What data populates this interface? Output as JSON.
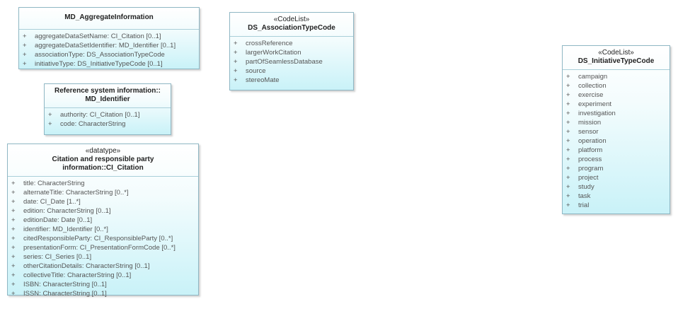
{
  "classes": {
    "md_aggregate": {
      "name": "MD_AggregateInformation",
      "attributes": [
        {
          "vis": "+",
          "text": "aggregateDataSetName: CI_Citation [0..1]"
        },
        {
          "vis": "+",
          "text": "aggregateDataSetIdentifier: MD_Identifier [0..1]"
        },
        {
          "vis": "+",
          "text": "associationType: DS_AssociationTypeCode"
        },
        {
          "vis": "+",
          "text": "initiativeType: DS_InitiativeTypeCode [0..1]"
        }
      ]
    },
    "md_identifier": {
      "name_line1": "Reference system information::",
      "name_line2": "MD_Identifier",
      "attributes": [
        {
          "vis": "+",
          "text": "authority: CI_Citation [0..1]"
        },
        {
          "vis": "+",
          "text": "code: CharacterString"
        }
      ]
    },
    "ci_citation": {
      "stereotype": "«datatype»",
      "name": "Citation and responsible party information::CI_Citation",
      "attributes": [
        {
          "vis": "+",
          "text": "title: CharacterString"
        },
        {
          "vis": "+",
          "text": "alternateTitle: CharacterString [0..*]"
        },
        {
          "vis": "+",
          "text": "date: CI_Date [1..*]"
        },
        {
          "vis": "+",
          "text": "edition: CharacterString [0..1]"
        },
        {
          "vis": "+",
          "text": "editionDate: Date [0..1]"
        },
        {
          "vis": "+",
          "text": "identifier: MD_Identifier [0..*]"
        },
        {
          "vis": "+",
          "text": "citedResponsibleParty: CI_ResponsibleParty [0..*]"
        },
        {
          "vis": "+",
          "text": "presentationForm: CI_PresentationFormCode [0..*]"
        },
        {
          "vis": "+",
          "text": "series: CI_Series [0..1]"
        },
        {
          "vis": "+",
          "text": "otherCitationDetails: CharacterString [0..1]"
        },
        {
          "vis": "+",
          "text": "collectiveTitle: CharacterString [0..1]"
        },
        {
          "vis": "+",
          "text": "ISBN: CharacterString [0..1]"
        },
        {
          "vis": "+",
          "text": "ISSN: CharacterString [0..1]"
        }
      ]
    },
    "association_type": {
      "stereotype": "«CodeList»",
      "name": "DS_AssociationTypeCode",
      "attributes": [
        {
          "vis": "+",
          "text": "crossReference"
        },
        {
          "vis": "+",
          "text": "largerWorkCitation"
        },
        {
          "vis": "+",
          "text": "partOfSeamlessDatabase"
        },
        {
          "vis": "+",
          "text": "source"
        },
        {
          "vis": "+",
          "text": "stereoMate"
        }
      ]
    },
    "initiative_type": {
      "stereotype": "«CodeList»",
      "name": "DS_InitiativeTypeCode",
      "attributes": [
        {
          "vis": "+",
          "text": "campaign"
        },
        {
          "vis": "+",
          "text": "collection"
        },
        {
          "vis": "+",
          "text": "exercise"
        },
        {
          "vis": "+",
          "text": "experiment"
        },
        {
          "vis": "+",
          "text": "investigation"
        },
        {
          "vis": "+",
          "text": "mission"
        },
        {
          "vis": "+",
          "text": "sensor"
        },
        {
          "vis": "+",
          "text": "operation"
        },
        {
          "vis": "+",
          "text": "platform"
        },
        {
          "vis": "+",
          "text": "process"
        },
        {
          "vis": "+",
          "text": "program"
        },
        {
          "vis": "+",
          "text": "project"
        },
        {
          "vis": "+",
          "text": "study"
        },
        {
          "vis": "+",
          "text": "task"
        },
        {
          "vis": "+",
          "text": "trial"
        }
      ]
    }
  }
}
